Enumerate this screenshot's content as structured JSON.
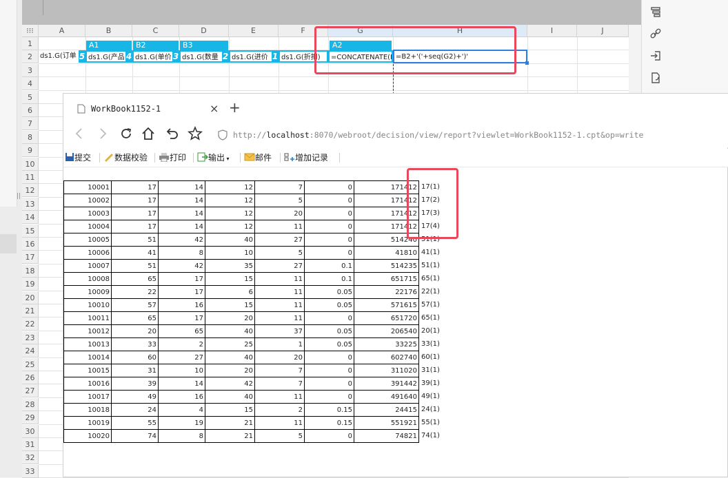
{
  "sheet": {
    "columns": [
      "A",
      "B",
      "C",
      "D",
      "E",
      "F",
      "G",
      "H",
      "I",
      "J"
    ],
    "rows": [
      "1",
      "2",
      "3",
      "4",
      "5",
      "6",
      "7",
      "8",
      "9",
      "10",
      "11",
      "12",
      "13",
      "14",
      "15",
      "16",
      "17",
      "18",
      "19",
      "20",
      "21",
      "22",
      "23",
      "24",
      "25",
      "26",
      "27",
      "28",
      "29",
      "30",
      "31",
      "32",
      "33"
    ],
    "tags": {
      "b1": "A1",
      "c1": "B2",
      "d1": "B3",
      "g1": "A2"
    },
    "row2": {
      "a": "ds1.G(订单",
      "a_badge": "5",
      "b": "ds1.G(产品",
      "b_badge": "4",
      "c": "ds1.G(单价",
      "c_badge": "3",
      "d": "ds1.G(数量",
      "d_badge": "2",
      "e": "ds1.G(进价",
      "e_badge": "1",
      "f": "ds1.G(折扣)",
      "g": "=CONCATENATE(B",
      "h": "=B2+'('+seq(G2)+')'"
    }
  },
  "right_panel": {
    "icons": [
      "cell-element-icon",
      "hyperlink-icon",
      "insert-icon",
      "export-icon"
    ]
  },
  "browser": {
    "tab_title": "WorkBook1152-1",
    "tab_close": "×",
    "new_tab": "+",
    "url_prefix": "http://",
    "url_host": "localhost",
    "url_rest": ":8070/webroot/decision/view/report?viewlet=WorkBook1152-1.cpt&op=write",
    "toolbar": {
      "submit": "提交",
      "validate": "数据校验",
      "print": "打印",
      "export": "输出",
      "mail": "邮件",
      "add_record": "增加记录"
    },
    "table": [
      [
        "10001",
        "17",
        "14",
        "12",
        "7",
        "0",
        "171412",
        "17(1)"
      ],
      [
        "10002",
        "17",
        "14",
        "12",
        "5",
        "0",
        "171412",
        "17(2)"
      ],
      [
        "10003",
        "17",
        "14",
        "12",
        "20",
        "0",
        "171412",
        "17(3)"
      ],
      [
        "10004",
        "17",
        "14",
        "12",
        "11",
        "0",
        "171412",
        "17(4)"
      ],
      [
        "10005",
        "51",
        "42",
        "40",
        "27",
        "0",
        "514240",
        "51(1)"
      ],
      [
        "10006",
        "41",
        "8",
        "10",
        "5",
        "0",
        "41810",
        "41(1)"
      ],
      [
        "10007",
        "51",
        "42",
        "35",
        "27",
        "0.1",
        "514235",
        "51(1)"
      ],
      [
        "10008",
        "65",
        "17",
        "15",
        "11",
        "0.1",
        "651715",
        "65(1)"
      ],
      [
        "10009",
        "22",
        "17",
        "6",
        "11",
        "0.05",
        "22176",
        "22(1)"
      ],
      [
        "10010",
        "57",
        "16",
        "15",
        "11",
        "0.05",
        "571615",
        "57(1)"
      ],
      [
        "10011",
        "65",
        "17",
        "20",
        "11",
        "0",
        "651720",
        "65(1)"
      ],
      [
        "10012",
        "20",
        "65",
        "40",
        "37",
        "0.05",
        "206540",
        "20(1)"
      ],
      [
        "10013",
        "33",
        "2",
        "25",
        "1",
        "0.05",
        "33225",
        "33(1)"
      ],
      [
        "10014",
        "60",
        "27",
        "40",
        "20",
        "0",
        "602740",
        "60(1)"
      ],
      [
        "10015",
        "31",
        "10",
        "20",
        "7",
        "0",
        "311020",
        "31(1)"
      ],
      [
        "10016",
        "39",
        "14",
        "42",
        "7",
        "0",
        "391442",
        "39(1)"
      ],
      [
        "10017",
        "49",
        "16",
        "40",
        "11",
        "0",
        "491640",
        "49(1)"
      ],
      [
        "10018",
        "24",
        "4",
        "15",
        "2",
        "0.15",
        "24415",
        "24(1)"
      ],
      [
        "10019",
        "55",
        "19",
        "21",
        "11",
        "0.15",
        "551921",
        "55(1)"
      ],
      [
        "10020",
        "74",
        "8",
        "21",
        "5",
        "0",
        "74821",
        "74(1)"
      ]
    ]
  },
  "colors": {
    "accent": "#17b6e6",
    "highlight": "#e8485c",
    "selection": "#2f7fe0"
  }
}
